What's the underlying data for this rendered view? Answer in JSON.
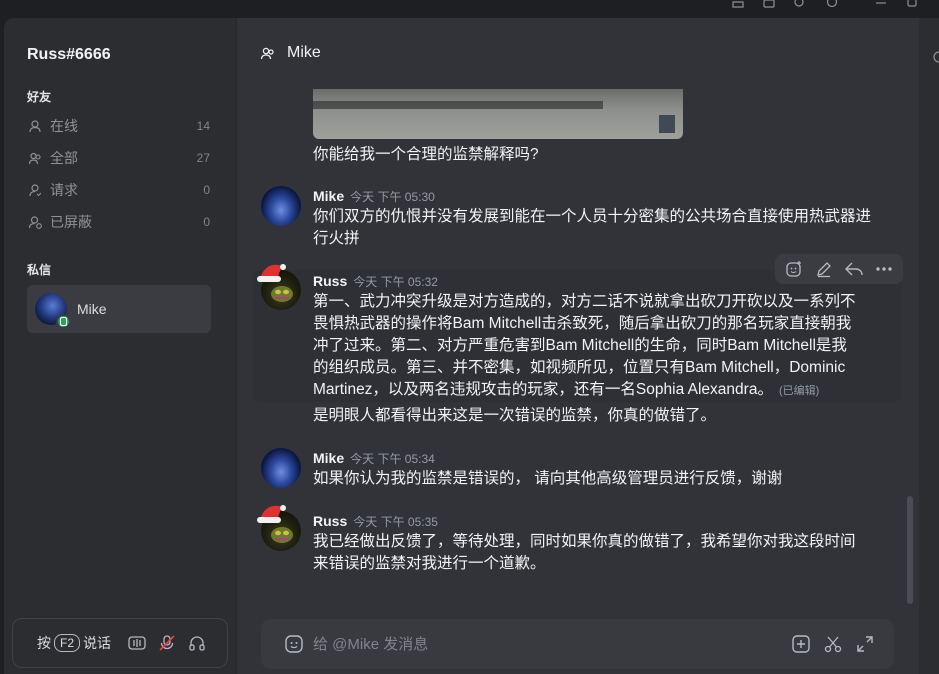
{
  "sidebar": {
    "user_title": "Russ#6666",
    "friends_label": "好友",
    "nav": [
      {
        "label": "在线",
        "count": "14",
        "icon": "user-icon"
      },
      {
        "label": "全部",
        "count": "27",
        "icon": "users-icon"
      },
      {
        "label": "请求",
        "count": "0",
        "icon": "user-request-icon"
      },
      {
        "label": "已屏蔽",
        "count": "0",
        "icon": "user-blocked-icon"
      }
    ],
    "dm_label": "私信",
    "dm_items": [
      {
        "name": "Mike"
      }
    ],
    "push_to_talk_prefix": "按",
    "push_to_talk_key": "F2",
    "push_to_talk_suffix": "说话"
  },
  "channel": {
    "title": "Mike"
  },
  "messages": {
    "m0_text": "你能给我一个合理的监禁解释吗?",
    "m1": {
      "author": "Mike",
      "time": "今天 下午 05:30",
      "text": "你们双方的仇恨并没有发展到能在一个人员十分密集的公共场合直接使用热武器进行火拼"
    },
    "m2": {
      "author": "Russ",
      "time": "今天 下午 05:32",
      "lines": [
        "第一、武力冲突升级是对方造成的，对方二话不说就拿出砍刀开砍以及一系列不",
        "畏惧热武器的操作将Bam Mitchell击杀致死，随后拿出砍刀的那名玩家直接朝我",
        "冲了过来。第二、对方严重危害到Bam Mitchell的生命，同时Bam Mitchell是我",
        "的组织成员。第三、并不密集，如视频所见，位置只有Bam Mitchell，Dominic",
        "Martinez，以及两名违规攻击的玩家，还有一名Sophia Alexandra。"
      ],
      "edited": "(已编辑)",
      "follow_up": "是明眼人都看得出来这是一次错误的监禁，你真的做错了。"
    },
    "m3": {
      "author": "Mike",
      "time": "今天 下午 05:34",
      "text": "如果你认为我的监禁是错误的， 请向其他高级管理员进行反馈，谢谢"
    },
    "m4": {
      "author": "Russ",
      "time": "今天 下午 05:35",
      "lines": [
        "我已经做出反馈了，等待处理，同时如果你真的做错了，我希望你对我这段时间",
        "来错误的监禁对我进行一个道歉。"
      ]
    }
  },
  "composer": {
    "placeholder": "给 @Mike 发消息"
  },
  "colors": {
    "online": "#23a55a",
    "muted_red": "#f23f43"
  }
}
